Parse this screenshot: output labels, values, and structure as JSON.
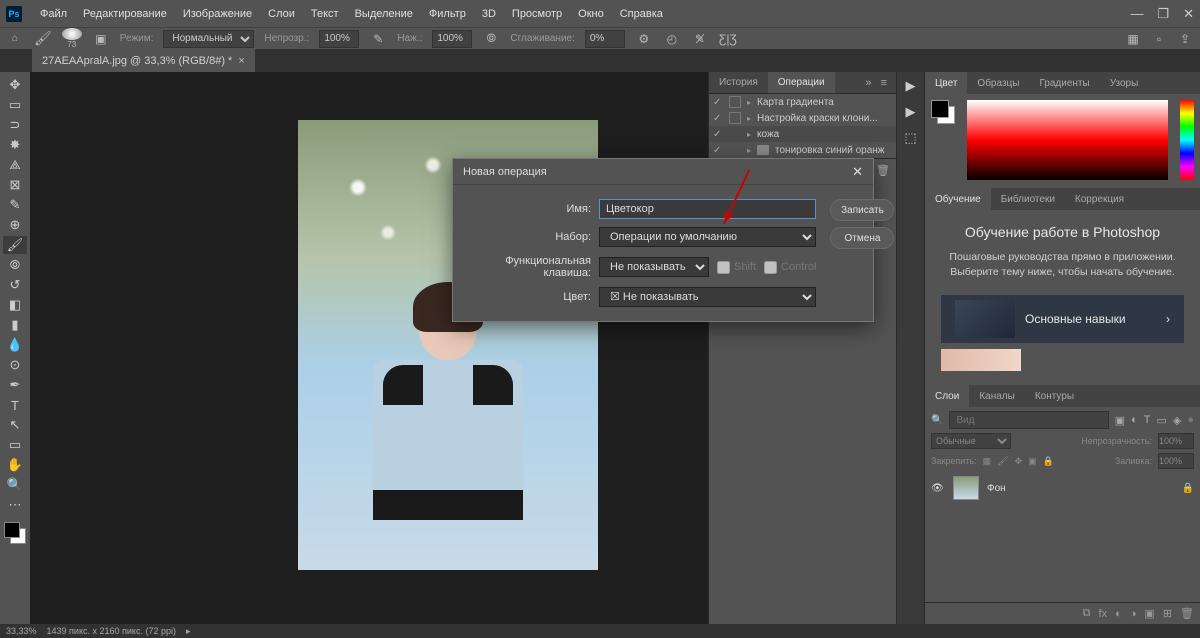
{
  "menu": [
    "Файл",
    "Редактирование",
    "Изображение",
    "Слои",
    "Текст",
    "Выделение",
    "Фильтр",
    "3D",
    "Просмотр",
    "Окно",
    "Справка"
  ],
  "options": {
    "brush_size": "73",
    "mode_label": "Режим:",
    "mode_value": "Нормальный",
    "opacity_label": "Непрозр.:",
    "opacity_value": "100%",
    "flow_label": "Наж.:",
    "flow_value": "100%",
    "smoothing_label": "Сглаживание:",
    "smoothing_value": "0%"
  },
  "tab": {
    "title": "27AEAApralA.jpg @ 33,3% (RGB/8#) *"
  },
  "actions_panel": {
    "tab_history": "История",
    "tab_actions": "Операции",
    "items": [
      "Карта градиента",
      "Настройка краски клони...",
      "кожа",
      "тонировка синий оранж"
    ]
  },
  "color_panel": {
    "tab_color": "Цвет",
    "tab_swatches": "Образцы",
    "tab_gradients": "Градиенты",
    "tab_patterns": "Узоры"
  },
  "learn_panel": {
    "tab_learn": "Обучение",
    "tab_libraries": "Библиотеки",
    "tab_correction": "Коррекция",
    "title": "Обучение работе в Photoshop",
    "desc": "Пошаговые руководства прямо в приложении. Выберите тему ниже, чтобы начать обучение.",
    "card1": "Основные навыки"
  },
  "layers_panel": {
    "tab_layers": "Слои",
    "tab_channels": "Каналы",
    "tab_paths": "Контуры",
    "search_placeholder": "Вид",
    "blend_mode": "Обычные",
    "opacity_label": "Непрозрачность:",
    "opacity_value": "100%",
    "lock_label": "Закрепить:",
    "fill_label": "Заливка:",
    "fill_value": "100%",
    "layer_name": "Фон"
  },
  "status": {
    "zoom": "33,33%",
    "dims": "1439 пикс. x 2160 пикс. (72 ppi)"
  },
  "dialog": {
    "title": "Новая операция",
    "name_label": "Имя:",
    "name_value": "Цветокор",
    "set_label": "Набор:",
    "set_value": "Операции по умолчанию",
    "fkey_label": "Функциональная клавиша:",
    "fkey_value": "Не показывать",
    "shift": "Shift",
    "control": "Control",
    "color_label": "Цвет:",
    "color_value": "Не показывать",
    "btn_record": "Записать",
    "btn_cancel": "Отмена"
  }
}
